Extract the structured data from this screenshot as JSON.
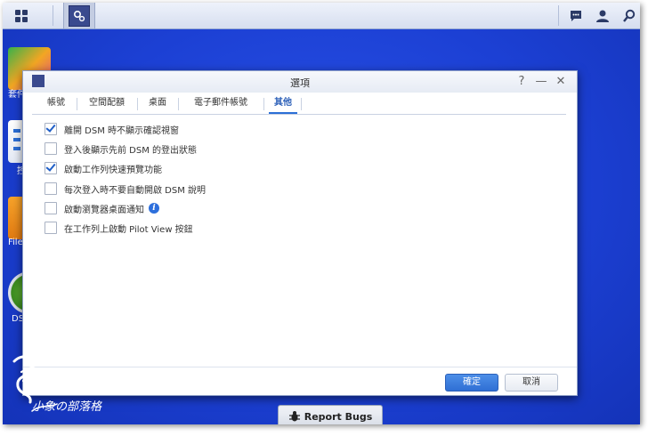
{
  "desktop": {
    "icons": [
      {
        "label": "套件"
      },
      {
        "label": "控"
      },
      {
        "label": "File"
      },
      {
        "label": "DS"
      }
    ]
  },
  "dialog": {
    "title": "選項",
    "controls": {
      "help": "?",
      "minimize": "—",
      "close": "✕"
    },
    "tabs": [
      {
        "label": "帳號"
      },
      {
        "label": "空間配額"
      },
      {
        "label": "桌面"
      },
      {
        "label": "電子郵件帳號"
      },
      {
        "label": "其他",
        "active": true
      }
    ],
    "options": [
      {
        "label": "離開 DSM 時不顯示確認視窗",
        "checked": true
      },
      {
        "label": "登入後顯示先前 DSM 的登出狀態",
        "checked": false
      },
      {
        "label": "啟動工作列快速預覽功能",
        "checked": true
      },
      {
        "label": "每次登入時不要自動開啟 DSM 說明",
        "checked": false
      },
      {
        "label": "啟動瀏覽器桌面通知",
        "checked": false,
        "info": "i"
      },
      {
        "label": "在工作列上啟動 Pilot View 按鈕",
        "checked": false
      }
    ],
    "ok_label": "確定",
    "cancel_label": "取消"
  },
  "report_bugs_label": "Report Bugs",
  "watermark": {
    "text": "小象の部落格"
  },
  "colors": {
    "accent": "#2f6fd4",
    "desktop": "#1b3fd6"
  }
}
